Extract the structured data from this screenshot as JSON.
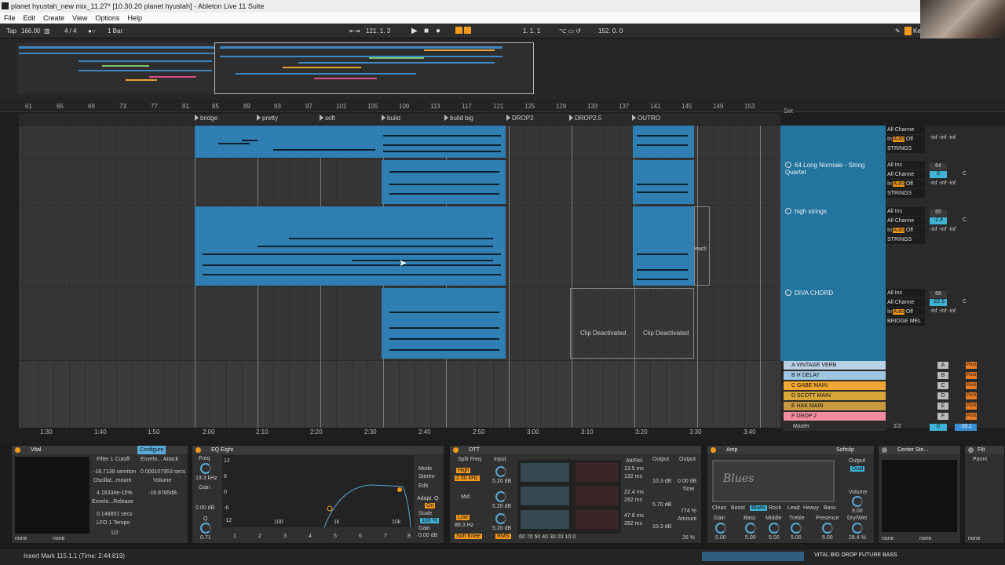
{
  "window": {
    "title": "planet hyustah_new mix_11.27*  [10.30.20 planet hyustah] - Ableton Live 11 Suite"
  },
  "menu": [
    "File",
    "Edit",
    "Create",
    "View",
    "Options",
    "Help"
  ],
  "transport": {
    "tap": "Tap",
    "tempo": "166.00",
    "signature": "4 / 4",
    "quantize": "1 Bar",
    "position": "121.  1.  3",
    "loop_start": "1.  1.  1",
    "loop_end": "152.  0.  0",
    "key_label": "Ke"
  },
  "ruler": [
    "81",
    "85",
    "89",
    "93",
    "97",
    "101",
    "105",
    "109",
    "113",
    "117",
    "121",
    "125",
    "129",
    "133",
    "137",
    "141",
    "145",
    "149",
    "153",
    "61",
    "65",
    "69",
    "73",
    "77"
  ],
  "locators": [
    "bridge",
    "pretty",
    "soft",
    "build",
    "build big",
    "DROP2",
    "DROP2.5",
    "OUTRO"
  ],
  "set_label": "Set",
  "clip_deactivated": "Clip Deactivated",
  "clip_cut": "eacti",
  "time_ticks": [
    "1:30",
    "1:40",
    "1:50",
    "2:00",
    "2:10",
    "2:20",
    "2:30",
    "2:40",
    "2:50",
    "3:00",
    "3:10",
    "3:20",
    "3:30",
    "3:40"
  ],
  "tracks": [
    {
      "name": "",
      "input": "All Channe",
      "auto": "Auto",
      "off": "Off",
      "out": "STRINGS",
      "vol": "",
      "pan": "C"
    },
    {
      "name": "64 Long Normale - String Quartet",
      "input_type": "All Ins",
      "input": "All Channe",
      "auto": "Auto",
      "off": "Off",
      "out": "STRINGS",
      "num": "64",
      "vol": "0",
      "pan": "C"
    },
    {
      "name": "high strings",
      "input_type": "All Ins",
      "input": "All Channe",
      "auto": "Auto",
      "off": "Off",
      "out": "STRINGS",
      "num": "65",
      "vol": "-2.4",
      "pan": "C"
    },
    {
      "name": "DIVA CHORD",
      "input_type": "All Ins",
      "input": "All Channe",
      "auto": "Auto",
      "off": "Off",
      "out": "BRIDGE MEL",
      "num": "66",
      "vol": "-22.5",
      "pan": "C"
    }
  ],
  "in_label": "In",
  "s_label": "S",
  "inf": "-inf",
  "returns": [
    {
      "name": "A VINTAGE VERB",
      "letter": "A",
      "color": "#b9cfe4"
    },
    {
      "name": "B H DELAY",
      "letter": "B",
      "color": "#9fc6e0"
    },
    {
      "name": "C GABE MAIN",
      "letter": "C",
      "color": "#f2a632"
    },
    {
      "name": "D SCOTT MAIN",
      "letter": "D",
      "color": "#d9a63a"
    },
    {
      "name": "E HAK MAIN",
      "letter": "E",
      "color": "#c99a42"
    },
    {
      "name": "F DROP 2",
      "letter": "F",
      "color": "#f28ea0"
    }
  ],
  "post": "Post",
  "master": {
    "name": "Master",
    "routing": "1/2",
    "vol": "0",
    "peak": "-10.1"
  },
  "devices": {
    "vital": {
      "name": "Vital",
      "configure": "Configure",
      "params": [
        "Filter 1 Cutoff",
        "Envelo... Attack",
        "-18.7138 semiton",
        "0.000107953 secs",
        "Oscillat...mount",
        "Volume",
        "4.16334e-15%",
        "-16.9785dB",
        "Envelo...Release",
        "0.146851 secs",
        "LFO 1 Tempo",
        "1/2"
      ],
      "none": "none"
    },
    "eq": {
      "name": "EQ Eight",
      "freq": "Freq",
      "freq_val": "13.3 kHz",
      "gain": "Gain",
      "gain_val": "0.00 dB",
      "q": "Q",
      "q_val": "0.71",
      "scale_ticks": [
        "12",
        "6",
        "0",
        "-6",
        "-12"
      ],
      "freq_ticks": [
        "100",
        "1k",
        "10k"
      ],
      "mode": "Mode",
      "mode_val": "Stereo",
      "edit": "Edit",
      "adapt": "Adapt. Q",
      "on": "On",
      "scale": "Scale",
      "scale_val": "100 %",
      "gain2": "Gain",
      "gain2_val": "0.00 dB",
      "bands": [
        "1",
        "2",
        "3",
        "4",
        "5",
        "6",
        "7",
        "8"
      ]
    },
    "ott": {
      "name": "OTT",
      "split": "Split Freq",
      "input": "Input",
      "high": "High",
      "high_freq": "2.50 kHz",
      "mid": "Mid",
      "low": "Low",
      "low_freq": "88.3 Hz",
      "in_vals": [
        "5.20 dB",
        "5.20 dB",
        "5.20 dB"
      ],
      "attrel": "Att/Rel",
      "times": [
        "13.5 ms",
        "132 ms",
        "22.4 ms",
        "282 ms",
        "47.8 ms",
        "282 ms"
      ],
      "output": "Output",
      "out_vals": [
        "10.3 dB",
        "5.70 dB",
        "10.3 dB"
      ],
      "output2": "Output",
      "output2_val": "0.00 dB",
      "time": "Time",
      "time_val": "774 %",
      "amount": "Amount",
      "amount_val": "26 %",
      "soft_knee": "Soft Knee",
      "rms": "RMS",
      "meter_ticks": [
        "60",
        "70",
        "50",
        "40",
        "30",
        "20",
        "10",
        "0"
      ]
    },
    "amp": {
      "name": "Amp",
      "softclip": "Softclip",
      "output": "Output",
      "dual": "Dual",
      "models": [
        "Clean",
        "Boost",
        "Blues",
        "Rock",
        "Lead",
        "Heavy",
        "Bass"
      ],
      "knobs": [
        {
          "label": "Gain",
          "val": "5.00"
        },
        {
          "label": "Bass",
          "val": "5.00"
        },
        {
          "label": "Middle",
          "val": "5.00"
        },
        {
          "label": "Treble",
          "val": "5.00"
        },
        {
          "label": "Presence",
          "val": "5.00"
        }
      ],
      "volume": "Volume",
      "volume_val": "9.00",
      "drywet": "Dry/Wet",
      "drywet_val": "28.4 %",
      "logo": "Blues"
    },
    "center": {
      "name": "Center Ste...",
      "extra": "Filt",
      "pann": "Panni"
    }
  },
  "status": {
    "message": "Insert Mark 115.1.1 (Time: 2:44:819)",
    "track_name": "VITAL BIG DROP FUTURE BASS"
  }
}
